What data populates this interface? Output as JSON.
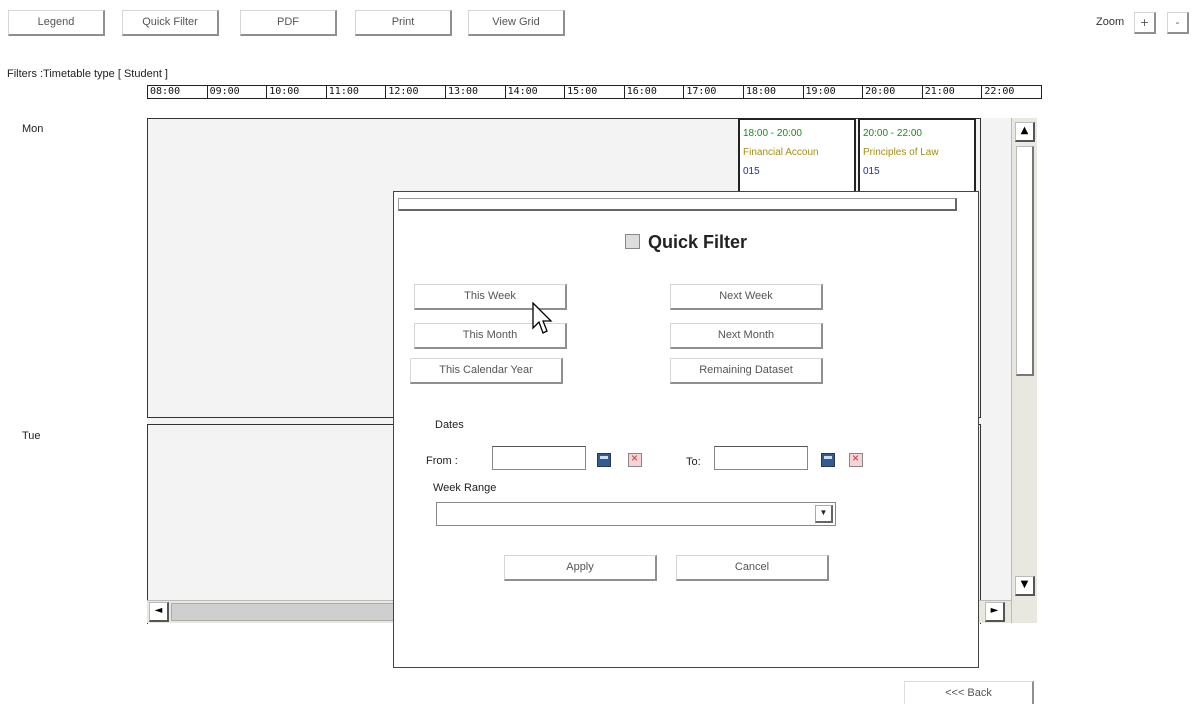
{
  "toolbar": {
    "legend": "Legend",
    "quick_filter": "Quick Filter",
    "pdf": "PDF",
    "print": "Print",
    "view_grid": "View Grid",
    "zoom_label": "Zoom",
    "zoom_in": "+",
    "zoom_out": "-"
  },
  "filters_text": "Filters :Timetable type [ Student ]",
  "time_slots": [
    "08:00",
    "09:00",
    "10:00",
    "11:00",
    "12:00",
    "13:00",
    "14:00",
    "15:00",
    "16:00",
    "17:00",
    "18:00",
    "19:00",
    "20:00",
    "21:00",
    "22:00"
  ],
  "days": [
    "Mon",
    "Tue"
  ],
  "events": [
    {
      "time": "18:00 - 20:00",
      "name": "Financial Accoun",
      "room": "015"
    },
    {
      "time": "20:00 - 22:00",
      "name": "Principles of Law",
      "room": "015"
    }
  ],
  "scrollbar": {
    "up": "▲",
    "down": "▼",
    "left": "◄",
    "right": "►"
  },
  "back_button": "<<< Back",
  "quick_filter_dialog": {
    "title": "Quick Filter",
    "this_week": "This Week",
    "next_week": "Next Week",
    "this_month": "This Month",
    "next_month": "Next Month",
    "this_calendar_year": "This Calendar Year",
    "remaining_dataset": "Remaining Dataset",
    "dates_label": "Dates",
    "from_label": "From :",
    "to_label": "To:",
    "from_value": "",
    "to_value": "",
    "week_range_label": "Week Range",
    "week_range_value": "",
    "apply": "Apply",
    "cancel": "Cancel"
  },
  "colors": {
    "event_time": "#1b8a1b",
    "event_name": "#a48f10",
    "event_room": "#1a2fa0",
    "calendar_icon": "#2d5d92"
  }
}
